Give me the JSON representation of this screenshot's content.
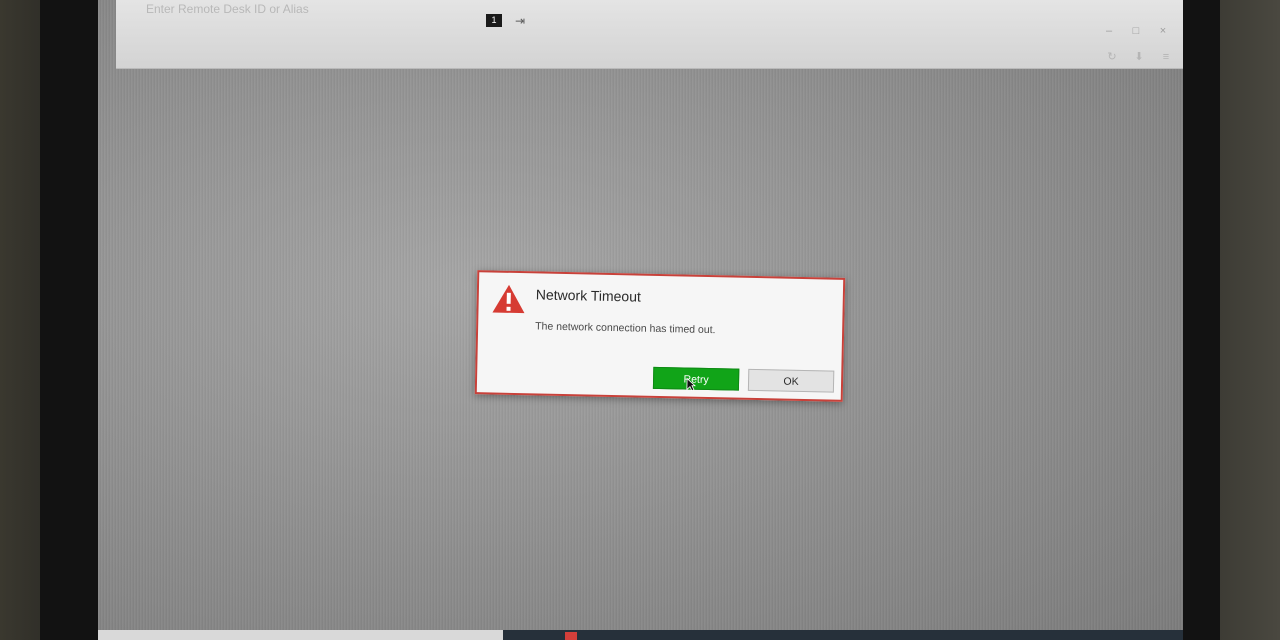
{
  "window": {
    "address_placeholder": "Enter Remote Desk ID or Alias",
    "monitor_badge": "1",
    "login_icon": "login-icon",
    "window_buttons": [
      "minimize-icon",
      "maximize-icon",
      "close-icon"
    ],
    "toolbar_icons": [
      "history-icon",
      "download-icon",
      "menu-icon"
    ]
  },
  "dialog": {
    "title": "Network Timeout",
    "message": "The network connection has timed out.",
    "icon": "warning-icon",
    "retry_label": "Retry",
    "ok_label": "OK",
    "colors": {
      "border": "#c8413a",
      "warning": "#d63b33",
      "retry": "#11a418"
    }
  }
}
